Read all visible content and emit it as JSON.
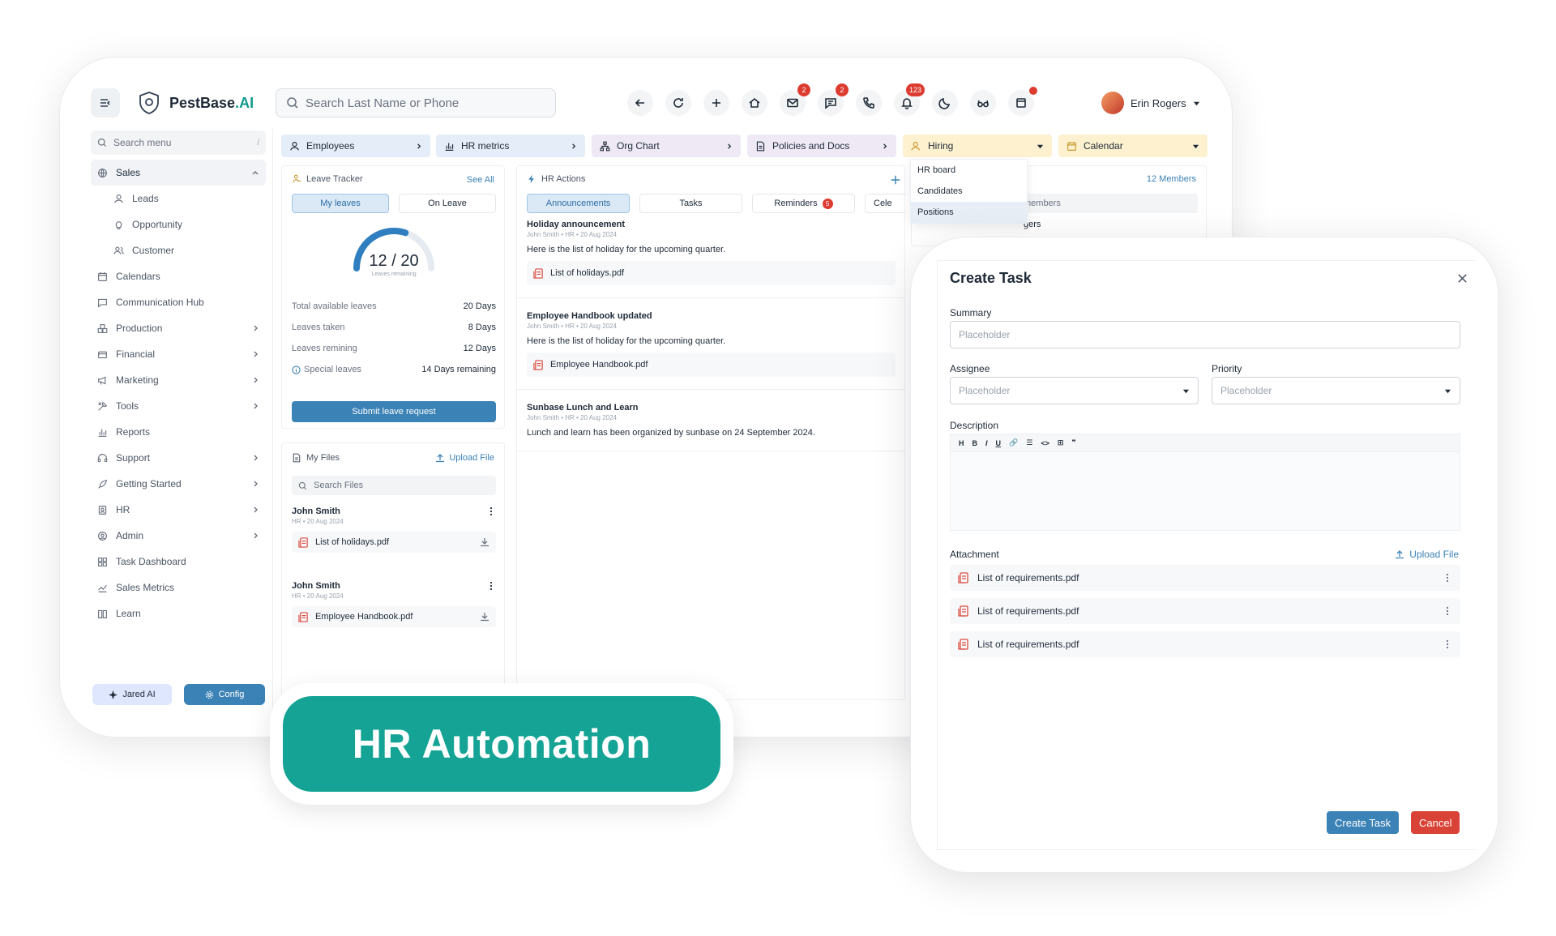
{
  "app": {
    "logo_prefix": "PestBase",
    "logo_suffix": ".AI"
  },
  "header": {
    "search_placeholder": "Search Last Name or Phone",
    "mail_badge": "2",
    "chat_badge": "2",
    "notif_badge": "123",
    "user_name": "Erin Rogers"
  },
  "sidebar": {
    "search_placeholder": "Search menu",
    "search_shortcut": "/",
    "items": [
      {
        "label": "Sales",
        "icon": "globe-icon"
      },
      {
        "label": "Leads",
        "icon": "person-icon"
      },
      {
        "label": "Opportunity",
        "icon": "bulb-icon"
      },
      {
        "label": "Customer",
        "icon": "users-icon"
      },
      {
        "label": "Calendars",
        "icon": "calendar-icon"
      },
      {
        "label": "Communication Hub",
        "icon": "chat-icon"
      },
      {
        "label": "Production",
        "icon": "boxes-icon"
      },
      {
        "label": "Financial",
        "icon": "wallet-icon"
      },
      {
        "label": "Marketing",
        "icon": "megaphone-icon"
      },
      {
        "label": "Tools",
        "icon": "tools-icon"
      },
      {
        "label": "Reports",
        "icon": "bar-chart-icon"
      },
      {
        "label": "Support",
        "icon": "headset-icon"
      },
      {
        "label": "Getting Started",
        "icon": "rocket-icon"
      },
      {
        "label": "HR",
        "icon": "id-card-icon"
      },
      {
        "label": "Admin",
        "icon": "admin-icon"
      },
      {
        "label": "Task Dashboard",
        "icon": "grid-icon"
      },
      {
        "label": "Sales Metrics",
        "icon": "line-chart-icon"
      },
      {
        "label": "Learn",
        "icon": "book-icon"
      }
    ],
    "jared_label": "Jared AI",
    "config_label": "Config"
  },
  "tabs": [
    {
      "label": "Employees",
      "color": "#e4edf8"
    },
    {
      "label": "HR metrics",
      "color": "#e4edf8"
    },
    {
      "label": "Org Chart",
      "color": "#efe9f6"
    },
    {
      "label": "Policies and Docs",
      "color": "#efe9f6"
    },
    {
      "label": "Hiring",
      "color": "#fdf1cf"
    },
    {
      "label": "Calendar",
      "color": "#fdf1cf"
    }
  ],
  "hiring_menu": [
    "HR board",
    "Candidates",
    "Positions"
  ],
  "leave": {
    "title": "Leave Tracker",
    "see_all": "See All",
    "tab_my": "My leaves",
    "tab_on": "On Leave",
    "remaining": "12 / 20",
    "remaining_fraction": 0.6,
    "remaining_caption": "Leaves remaining",
    "rows": [
      {
        "label": "Total available leaves",
        "value": "20 Days"
      },
      {
        "label": "Leaves taken",
        "value": "8 Days"
      },
      {
        "label": "Leaves remining",
        "value": "12 Days"
      },
      {
        "label": "Special leaves",
        "value": "14 Days remaining"
      }
    ],
    "submit": "Submit leave request"
  },
  "files": {
    "title": "My Files",
    "upload": "Upload File",
    "search_placeholder": "Search Files",
    "entries": [
      {
        "author": "John Smith",
        "meta": "HR  •  20 Aug 2024",
        "file": "List of holidays.pdf"
      },
      {
        "author": "John Smith",
        "meta": "HR  •  20 Aug 2024",
        "file": "Employee Handbook.pdf"
      }
    ]
  },
  "hr_actions": {
    "title": "HR Actions",
    "tabs": [
      "Announcements",
      "Tasks",
      "Reminders",
      "Cele"
    ],
    "reminders_badge": "5",
    "posts": [
      {
        "title": "Holiday announcement",
        "meta": "John Smith  •  HR  •  20 Aug 2024",
        "body": "Here is the list of holiday for the upcoming quarter.",
        "file": "List of holidays.pdf"
      },
      {
        "title": "Employee Handbook updated",
        "meta": "John Smith  •  HR  •  20 Aug 2024",
        "body": "Here is the list of holiday for the upcoming quarter.",
        "file": "Employee Handbook.pdf"
      },
      {
        "title": "Sunbase Lunch and Learn",
        "meta": "John Smith  •  HR  •  20 Aug 2024",
        "body": "Lunch and learn has been organized by sunbase on 24 September 2024."
      }
    ]
  },
  "team": {
    "members_link": "12 Members",
    "members_label": "members",
    "clipped_text": "gers"
  },
  "badge": {
    "text": "HR Automation"
  },
  "task": {
    "title": "Create Task",
    "summary_label": "Summary",
    "summary_placeholder": "Placeholder",
    "assignee_label": "Assignee",
    "assignee_placeholder": "Placeholder",
    "priority_label": "Priority",
    "priority_placeholder": "Placeholder",
    "description_label": "Description",
    "editor_tools": [
      "H",
      "B",
      "I",
      "U",
      "🔗",
      "☰",
      "<>",
      "⊞",
      "❞"
    ],
    "attachment_label": "Attachment",
    "upload_label": "Upload File",
    "attachments": [
      "List of requirements.pdf",
      "List of requirements.pdf",
      "List of requirements.pdf"
    ],
    "create_label": "Create Task",
    "cancel_label": "Cancel"
  }
}
